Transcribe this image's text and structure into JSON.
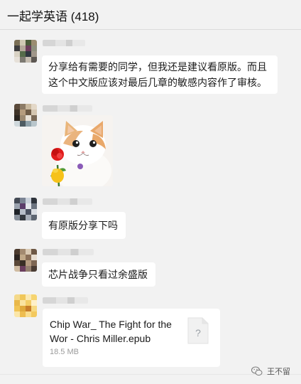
{
  "header": {
    "title": "一起学英语 (418)"
  },
  "messages": [
    {
      "lines": [
        "分享给有需要的同学，但我还是建议看原版。而且",
        "这个中文版应该对最后几章的敏感内容作了审核。"
      ]
    },
    {
      "image": "cat-with-rose-sticker"
    },
    {
      "lines": [
        "有原版分享下吗"
      ]
    },
    {
      "lines": [
        "芯片战争只看过余盛版"
      ]
    },
    {
      "file": {
        "name_lines": [
          "Chip War_ The Fight for the",
          "Wor - Chris Miller.epub"
        ],
        "size": "18.5 MB",
        "icon": "question-doc-icon"
      }
    }
  ],
  "watermark": {
    "text": "王不留"
  },
  "colors": {
    "background": "#f2f2f2",
    "bubble": "#ffffff",
    "title": "#111111"
  }
}
